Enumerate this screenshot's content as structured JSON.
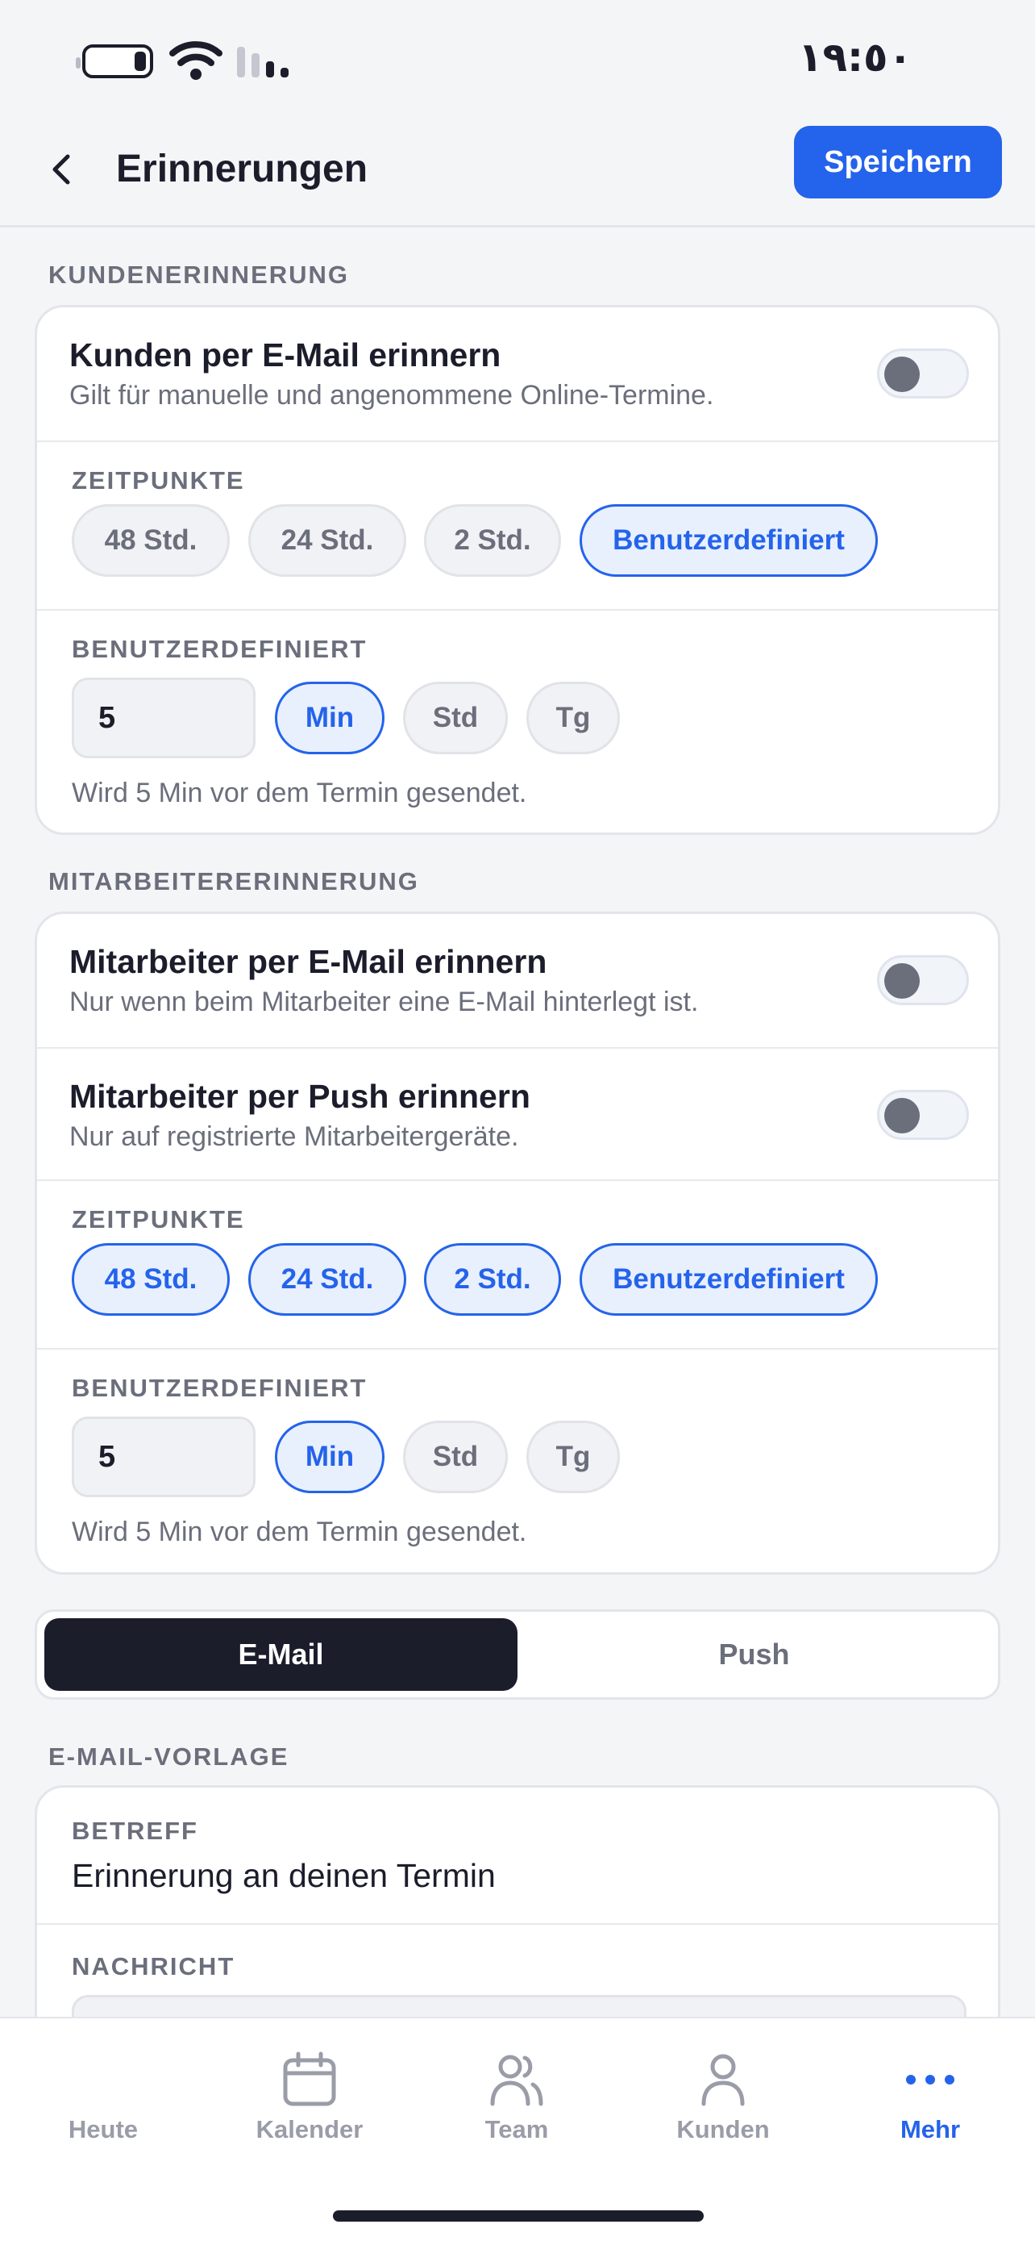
{
  "status_bar": {
    "time": "١٩:٥٠"
  },
  "header": {
    "title": "Erinnerungen",
    "save_label": "Speichern"
  },
  "customer_section": {
    "label": "KUNDENERINNERUNG",
    "email_toggle": {
      "title": "Kunden per E-Mail erinnern",
      "subtitle": "Gilt für manuelle und angenommene Online-Termine.",
      "on": false
    },
    "times_label": "ZEITPUNKTE",
    "times": [
      {
        "label": "48 Std.",
        "selected": false
      },
      {
        "label": "24 Std.",
        "selected": false
      },
      {
        "label": "2 Std.",
        "selected": false
      },
      {
        "label": "Benutzerdefiniert",
        "selected": true
      }
    ],
    "custom_label": "BENUTZERDEFINIERT",
    "custom_value": "5",
    "units": [
      {
        "label": "Min",
        "selected": true
      },
      {
        "label": "Std",
        "selected": false
      },
      {
        "label": "Tg",
        "selected": false
      }
    ],
    "hint": "Wird 5 Min vor dem Termin gesendet."
  },
  "staff_section": {
    "label": "MITARBEITERERINNERUNG",
    "email_toggle": {
      "title": "Mitarbeiter per E-Mail erinnern",
      "subtitle": "Nur wenn beim Mitarbeiter eine E-Mail hinterlegt ist.",
      "on": false
    },
    "push_toggle": {
      "title": "Mitarbeiter per Push erinnern",
      "subtitle": "Nur auf registrierte Mitarbeitergeräte.",
      "on": false
    },
    "times_label": "ZEITPUNKTE",
    "times": [
      {
        "label": "48 Std.",
        "selected": true
      },
      {
        "label": "24 Std.",
        "selected": true
      },
      {
        "label": "2 Std.",
        "selected": true
      },
      {
        "label": "Benutzerdefiniert",
        "selected": true
      }
    ],
    "custom_label": "BENUTZERDEFINIERT",
    "custom_value": "5",
    "units": [
      {
        "label": "Min",
        "selected": true
      },
      {
        "label": "Std",
        "selected": false
      },
      {
        "label": "Tg",
        "selected": false
      }
    ],
    "hint": "Wird 5 Min vor dem Termin gesendet."
  },
  "channel_tabs": {
    "email": "E-Mail",
    "push": "Push",
    "selected": "email"
  },
  "template_section": {
    "label": "E-MAIL-VORLAGE",
    "subject_label": "BETREFF",
    "subject_value": "Erinnerung an deinen Termin",
    "message_label": "NACHRICHT"
  },
  "tab_bar": {
    "items": [
      {
        "label": "Heute",
        "icon": "calendar-check-icon"
      },
      {
        "label": "Kalender",
        "icon": "calendar-icon"
      },
      {
        "label": "Team",
        "icon": "users-icon"
      },
      {
        "label": "Kunden",
        "icon": "user-icon"
      },
      {
        "label": "Mehr",
        "icon": "more-icon"
      }
    ],
    "active": "Mehr"
  },
  "colors": {
    "accent": "#2463eb",
    "dark": "#1c1d2b",
    "muted": "#6b6e7b"
  }
}
